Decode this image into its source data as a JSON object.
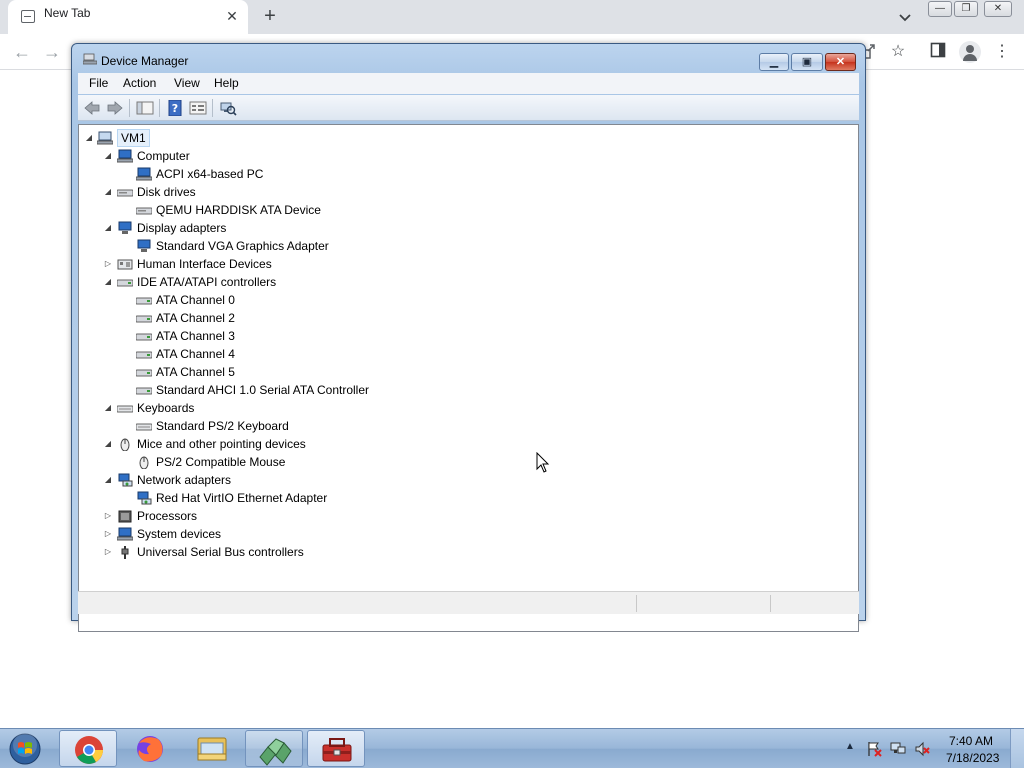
{
  "browser": {
    "tab_title": "New Tab",
    "tab_close": "✕",
    "new_tab": "+"
  },
  "device_manager": {
    "title": "Device Manager",
    "menu": [
      "File",
      "Action",
      "View",
      "Help"
    ],
    "tree": {
      "root": "VM1",
      "categories": [
        {
          "label": "Computer",
          "icon": "computer-icon",
          "expanded": true,
          "children": [
            "ACPI x64-based PC"
          ]
        },
        {
          "label": "Disk drives",
          "icon": "disk-drive-icon",
          "expanded": true,
          "children": [
            "QEMU HARDDISK ATA Device"
          ]
        },
        {
          "label": "Display adapters",
          "icon": "display-adapter-icon",
          "expanded": true,
          "children": [
            "Standard VGA Graphics Adapter"
          ]
        },
        {
          "label": "Human Interface Devices",
          "icon": "hid-icon",
          "expanded": false,
          "children": []
        },
        {
          "label": "IDE ATA/ATAPI controllers",
          "icon": "ide-controller-icon",
          "expanded": true,
          "children": [
            "ATA Channel 0",
            "ATA Channel 2",
            "ATA Channel 3",
            "ATA Channel 4",
            "ATA Channel 5",
            "Standard AHCI 1.0 Serial ATA Controller"
          ]
        },
        {
          "label": "Keyboards",
          "icon": "keyboard-icon",
          "expanded": true,
          "children": [
            "Standard PS/2 Keyboard"
          ]
        },
        {
          "label": "Mice and other pointing devices",
          "icon": "mouse-icon",
          "expanded": true,
          "children": [
            "PS/2 Compatible Mouse"
          ]
        },
        {
          "label": "Network adapters",
          "icon": "network-adapter-icon",
          "expanded": true,
          "children": [
            "Red Hat VirtIO Ethernet Adapter"
          ]
        },
        {
          "label": "Processors",
          "icon": "processor-icon",
          "expanded": false,
          "children": []
        },
        {
          "label": "System devices",
          "icon": "system-device-icon",
          "expanded": false,
          "children": []
        },
        {
          "label": "Universal Serial Bus controllers",
          "icon": "usb-icon",
          "expanded": false,
          "children": []
        }
      ]
    }
  },
  "taskbar": {
    "apps": [
      "chrome-icon",
      "firefox-icon",
      "file-explorer-icon",
      "network-app-icon",
      "device-manager-icon"
    ],
    "clock_time": "7:40 AM",
    "clock_date": "7/18/2023"
  },
  "colors": {
    "window_frame": "#a9c6e6",
    "taskbar": "#98b6d8",
    "selection": "#e5f0fb"
  }
}
